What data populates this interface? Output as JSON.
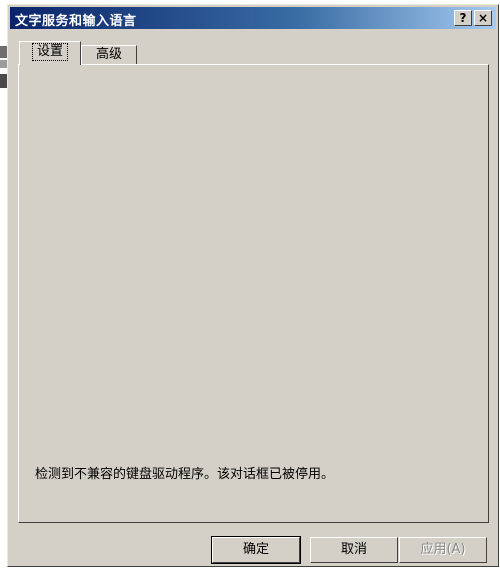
{
  "window": {
    "title": "文字服务和输入语言",
    "help_label": "?",
    "close_label": "×"
  },
  "tabs": [
    {
      "label": "设置",
      "active": true
    },
    {
      "label": "高级",
      "active": false
    }
  ],
  "panel": {
    "message": "检测到不兼容的键盘驱动程序。该对话框已被停用。"
  },
  "buttons": {
    "ok_label": "确定",
    "cancel_label": "取消",
    "apply_label": "应用(A)",
    "apply_enabled": false
  }
}
